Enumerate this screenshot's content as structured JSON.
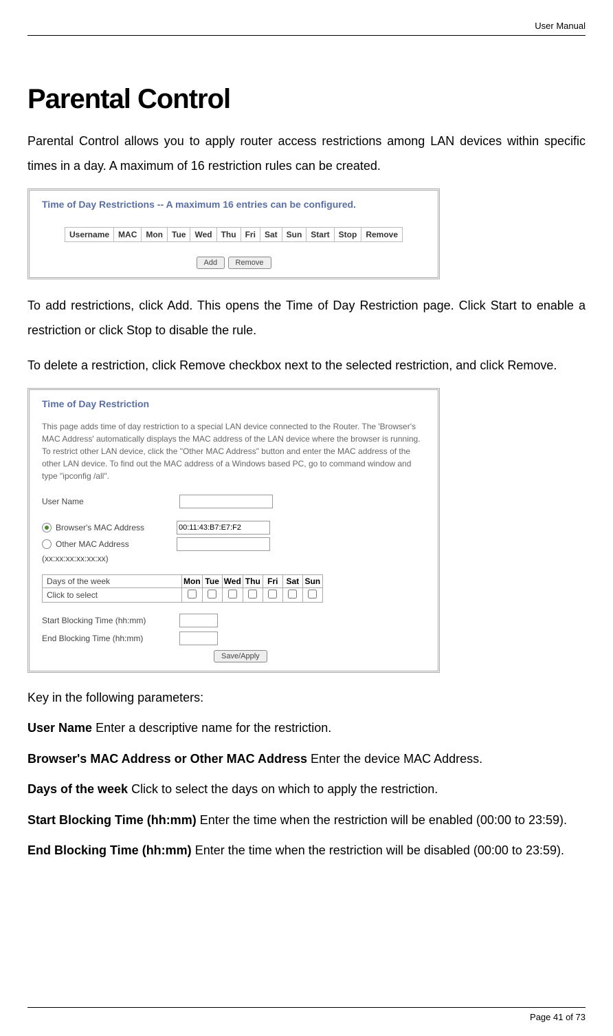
{
  "header": {
    "doc_title": "User Manual"
  },
  "heading": "Parental Control",
  "intro": "Parental Control allows you to apply router access restrictions among LAN devices within specific times in a day. A maximum of 16 restriction rules can be created.",
  "box1": {
    "title": "Time of Day Restrictions -- A maximum 16 entries can be configured.",
    "columns": [
      "Username",
      "MAC",
      "Mon",
      "Tue",
      "Wed",
      "Thu",
      "Fri",
      "Sat",
      "Sun",
      "Start",
      "Stop",
      "Remove"
    ],
    "buttons": {
      "add": "Add",
      "remove": "Remove"
    }
  },
  "para2": "To add restrictions, click Add. This opens the Time of Day Restriction page. Click Start to enable a restriction or click Stop to disable the rule.",
  "para3": "To delete a restriction, click Remove checkbox next to the selected restriction, and click Remove.",
  "box2": {
    "title": "Time of Day Restriction",
    "desc": "This page adds time of day restriction to a special LAN device connected to the Router. The 'Browser's MAC Address' automatically displays the MAC address of the LAN device where the browser is running. To restrict other LAN device, click the \"Other MAC Address\" button and enter the MAC address of the other LAN device. To find out the MAC address of a Windows based PC, go to command window and type \"ipconfig /all\".",
    "user_name_label": "User Name",
    "browser_mac_label": "Browser's MAC Address",
    "browser_mac_value": "00:11:43:B7:E7:F2",
    "other_mac_label": "Other MAC Address",
    "other_mac_format": "(xx:xx:xx:xx:xx:xx)",
    "days_label": "Days of the week",
    "click_select_label": "Click to select",
    "days": [
      "Mon",
      "Tue",
      "Wed",
      "Thu",
      "Fri",
      "Sat",
      "Sun"
    ],
    "start_label": "Start Blocking Time (hh:mm)",
    "end_label": "End Blocking Time (hh:mm)",
    "save_button": "Save/Apply"
  },
  "key_in": "Key in the following parameters:",
  "params": {
    "user_name": {
      "label": "User Name",
      "text": " Enter a descriptive name for the restriction."
    },
    "mac": {
      "label": "Browser's MAC Address or Other MAC Address",
      "text": " Enter the device MAC Address."
    },
    "days": {
      "label": "Days of the week",
      "text": " Click to select the days on which to apply the restriction."
    },
    "start": {
      "label": "Start Blocking Time (hh:mm)",
      "text": " Enter the time when the restriction will be enabled (00:00 to 23:59)."
    },
    "end": {
      "label": "End Blocking Time (hh:mm)",
      "text": " Enter the time when the restriction will be disabled (00:00 to 23:59)."
    }
  },
  "footer": {
    "page_info": "Page 41 of 73"
  }
}
